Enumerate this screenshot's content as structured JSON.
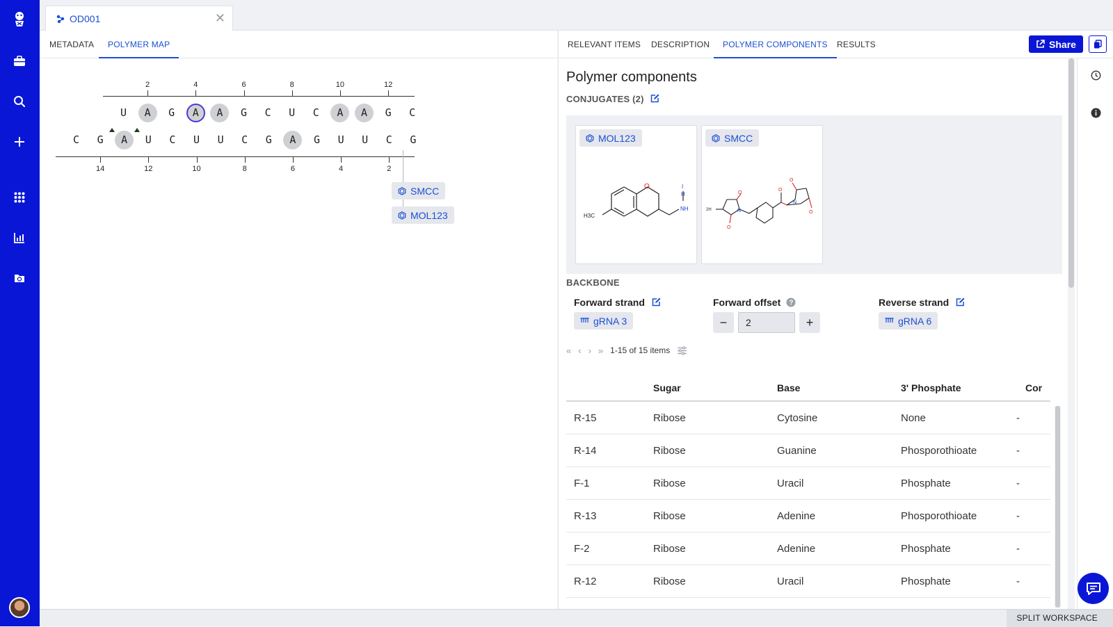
{
  "document_tab": {
    "title": "OD001"
  },
  "left_tabs": [
    {
      "label": "METADATA"
    },
    {
      "label": "POLYMER MAP"
    }
  ],
  "polymer_map": {
    "forward_ticks": [
      "2",
      "4",
      "6",
      "8",
      "10",
      "12"
    ],
    "reverse_ticks": [
      "14",
      "12",
      "10",
      "8",
      "6",
      "4",
      "2"
    ],
    "forward_strand": [
      {
        "base": "U",
        "state": "normal"
      },
      {
        "base": "A",
        "state": "modified"
      },
      {
        "base": "G",
        "state": "normal"
      },
      {
        "base": "A",
        "state": "selected"
      },
      {
        "base": "A",
        "state": "modified"
      },
      {
        "base": "G",
        "state": "normal"
      },
      {
        "base": "C",
        "state": "normal"
      },
      {
        "base": "U",
        "state": "normal"
      },
      {
        "base": "C",
        "state": "normal"
      },
      {
        "base": "A",
        "state": "modified"
      },
      {
        "base": "A",
        "state": "modified"
      },
      {
        "base": "G",
        "state": "normal"
      },
      {
        "base": "C",
        "state": "normal"
      }
    ],
    "reverse_strand": [
      {
        "base": "C",
        "state": "normal"
      },
      {
        "base": "G",
        "state": "normal"
      },
      {
        "base": "A",
        "state": "modified"
      },
      {
        "base": "U",
        "state": "normal"
      },
      {
        "base": "C",
        "state": "normal"
      },
      {
        "base": "U",
        "state": "normal"
      },
      {
        "base": "U",
        "state": "normal"
      },
      {
        "base": "C",
        "state": "normal"
      },
      {
        "base": "G",
        "state": "normal"
      },
      {
        "base": "A",
        "state": "modified"
      },
      {
        "base": "G",
        "state": "normal"
      },
      {
        "base": "U",
        "state": "normal"
      },
      {
        "base": "U",
        "state": "normal"
      },
      {
        "base": "C",
        "state": "normal"
      },
      {
        "base": "G",
        "state": "normal"
      }
    ],
    "conjugate_chips": [
      "SMCC",
      "MOL123"
    ]
  },
  "right_tabs": [
    {
      "label": "RELEVANT ITEMS"
    },
    {
      "label": "DESCRIPTION"
    },
    {
      "label": "POLYMER COMPONENTS"
    },
    {
      "label": "RESULTS"
    }
  ],
  "share_label": "Share",
  "page_title": "Polymer components",
  "conjugates": {
    "label": "CONJUGATES (2)",
    "cards": [
      {
        "name": "MOL123",
        "structure_text": "H3C"
      },
      {
        "name": "SMCC",
        "structure_text": "2H"
      }
    ]
  },
  "backbone": {
    "label": "BACKBONE",
    "forward_strand_label": "Forward strand",
    "forward_strand_value": "gRNA 3",
    "forward_offset_label": "Forward offset",
    "forward_offset_value": "2",
    "reverse_strand_label": "Reverse strand",
    "reverse_strand_value": "gRNA 6"
  },
  "pager": {
    "summary": "1-15 of 15 items"
  },
  "table": {
    "columns": [
      "Sugar",
      "Base",
      "3' Phosphate",
      "Cor"
    ],
    "rows": [
      {
        "id": "R-15",
        "sugar": "Ribose",
        "base": "Cytosine",
        "phosphate": "None",
        "extra": "-"
      },
      {
        "id": "R-14",
        "sugar": "Ribose",
        "base": "Guanine",
        "phosphate": "Phosporothioate",
        "extra": "-"
      },
      {
        "id": "F-1",
        "sugar": "Ribose",
        "base": "Uracil",
        "phosphate": "Phosphate",
        "extra": "-"
      },
      {
        "id": "R-13",
        "sugar": "Ribose",
        "base": "Adenine",
        "phosphate": "Phosporothioate",
        "extra": "-"
      },
      {
        "id": "F-2",
        "sugar": "Ribose",
        "base": "Adenine",
        "phosphate": "Phosphate",
        "extra": "-"
      },
      {
        "id": "R-12",
        "sugar": "Ribose",
        "base": "Uracil",
        "phosphate": "Phosphate",
        "extra": "-"
      }
    ]
  },
  "status_bar": {
    "split_label": "SPLIT WORKSPACE"
  },
  "colors": {
    "brand": "#0a16d6",
    "link": "#1a4fd6",
    "modified_base": "#cfd0d4"
  }
}
